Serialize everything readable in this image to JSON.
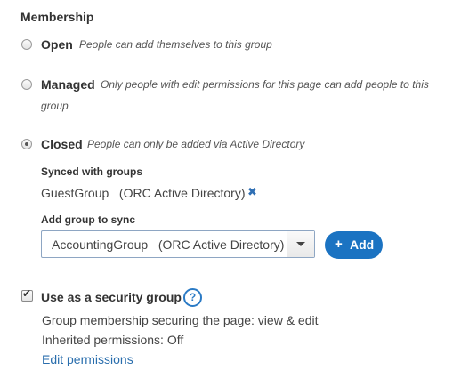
{
  "membership": {
    "title": "Membership",
    "options": [
      {
        "title": "Open",
        "description": "People can add themselves to this group",
        "selected": false
      },
      {
        "title": "Managed",
        "description": "Only people with edit permissions for this page can add people to this",
        "description_line2": "group",
        "selected": false
      },
      {
        "title": "Closed",
        "description": "People can only be added via Active Directory",
        "selected": true
      }
    ]
  },
  "synced": {
    "label": "Synced with groups",
    "groups": [
      {
        "name": "GuestGroup   (ORC Active Directory)",
        "remove_icon": "close-icon",
        "remove_glyph": "✖"
      }
    ]
  },
  "add_group": {
    "label": "Add group to sync",
    "selected_value": "AccountingGroup   (ORC Active Directory)",
    "button_label": "Add",
    "button_icon": "plus-icon",
    "button_glyph": "+"
  },
  "security": {
    "checkbox_label": "Use as a security group",
    "checked": true,
    "check_glyph": "✔",
    "help_glyph": "?",
    "membership_text": "Group membership securing the page: view & edit",
    "inherited_text": "Inherited permissions: Off",
    "edit_link": "Edit permissions"
  },
  "colors": {
    "accent": "#1b73c2",
    "link": "#2a6ead"
  }
}
